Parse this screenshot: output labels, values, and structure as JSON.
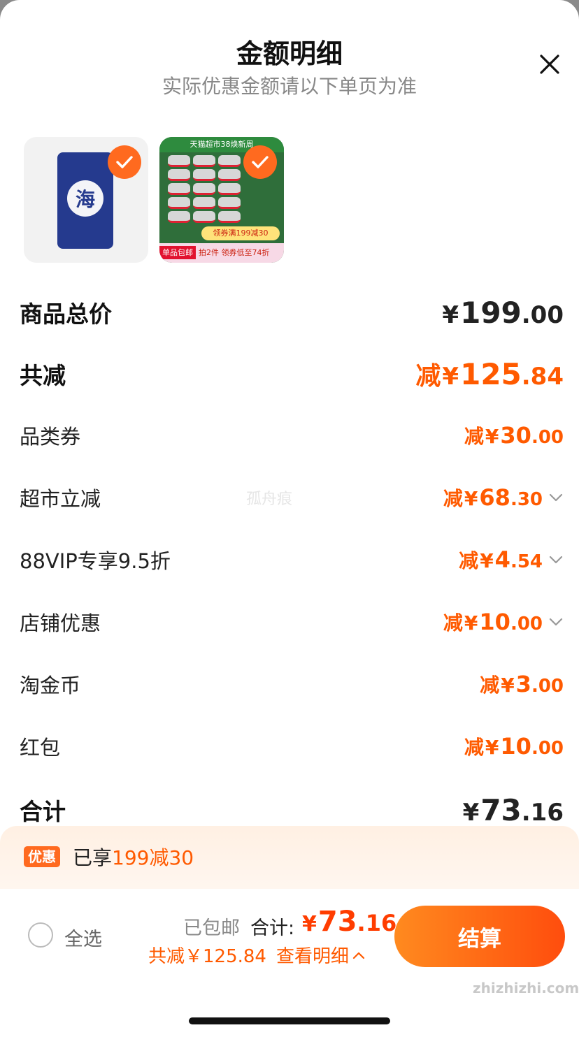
{
  "header": {
    "title": "金额明细",
    "subtitle": "实际优惠金额请以下单页为准"
  },
  "products": [
    {
      "name": "海",
      "selected": true
    },
    {
      "selected": true,
      "promo_top": "天猫超市38焕新周",
      "promo_mid": "领券满199减30",
      "tag": "单品包邮",
      "promo_bottom": "拍2件 领券低至74折"
    }
  ],
  "summary": {
    "total_label": "商品总价",
    "total_yen": "¥",
    "total_int": "199",
    "total_dec": ".00",
    "discount_label": "共减",
    "discount_prefix": "减",
    "discount_yen": "¥",
    "discount_int": "125",
    "discount_dec": ".84"
  },
  "discounts": [
    {
      "label": "品类券",
      "prefix": "减",
      "yen": "¥",
      "int": "30",
      "dec": ".00",
      "expandable": false
    },
    {
      "label": "超市立减",
      "prefix": "减",
      "yen": "¥",
      "int": "68",
      "dec": ".30",
      "expandable": true
    },
    {
      "label": "88VIP专享9.5折",
      "prefix": "减",
      "yen": "¥",
      "int": "4",
      "dec": ".54",
      "expandable": true
    },
    {
      "label": "店铺优惠",
      "prefix": "减",
      "yen": "¥",
      "int": "10",
      "dec": ".00",
      "expandable": true
    },
    {
      "label": "淘金币",
      "prefix": "减",
      "yen": "¥",
      "int": "3",
      "dec": ".00",
      "expandable": false
    },
    {
      "label": "红包",
      "prefix": "减",
      "yen": "¥",
      "int": "10",
      "dec": ".00",
      "expandable": false
    }
  ],
  "grand_total": {
    "label": "合计",
    "yen": "¥",
    "int": "73",
    "dec": ".16"
  },
  "watermark": "孤舟痕",
  "promo_bar": {
    "badge": "优惠",
    "text_prefix": "已享",
    "text_highlight": "199减30"
  },
  "footer": {
    "select_all": "全选",
    "free_shipping": "已包邮",
    "total_label": "合计:",
    "total_yen": "¥",
    "total_int": "73",
    "total_dec": ".16",
    "saved_text": "共减￥125.84",
    "view_details": "查看明细",
    "checkout": "结算"
  },
  "site_mark": "zhizhizhi.com",
  "colors": {
    "accent": "#ff5a00",
    "checkout_gradient_start": "#ff8a1f",
    "checkout_gradient_end": "#ff4d0d",
    "badge": "#ff6a1f"
  },
  "icons": [
    "close-icon",
    "check-icon",
    "chevron-down-icon",
    "chevron-up-icon"
  ]
}
